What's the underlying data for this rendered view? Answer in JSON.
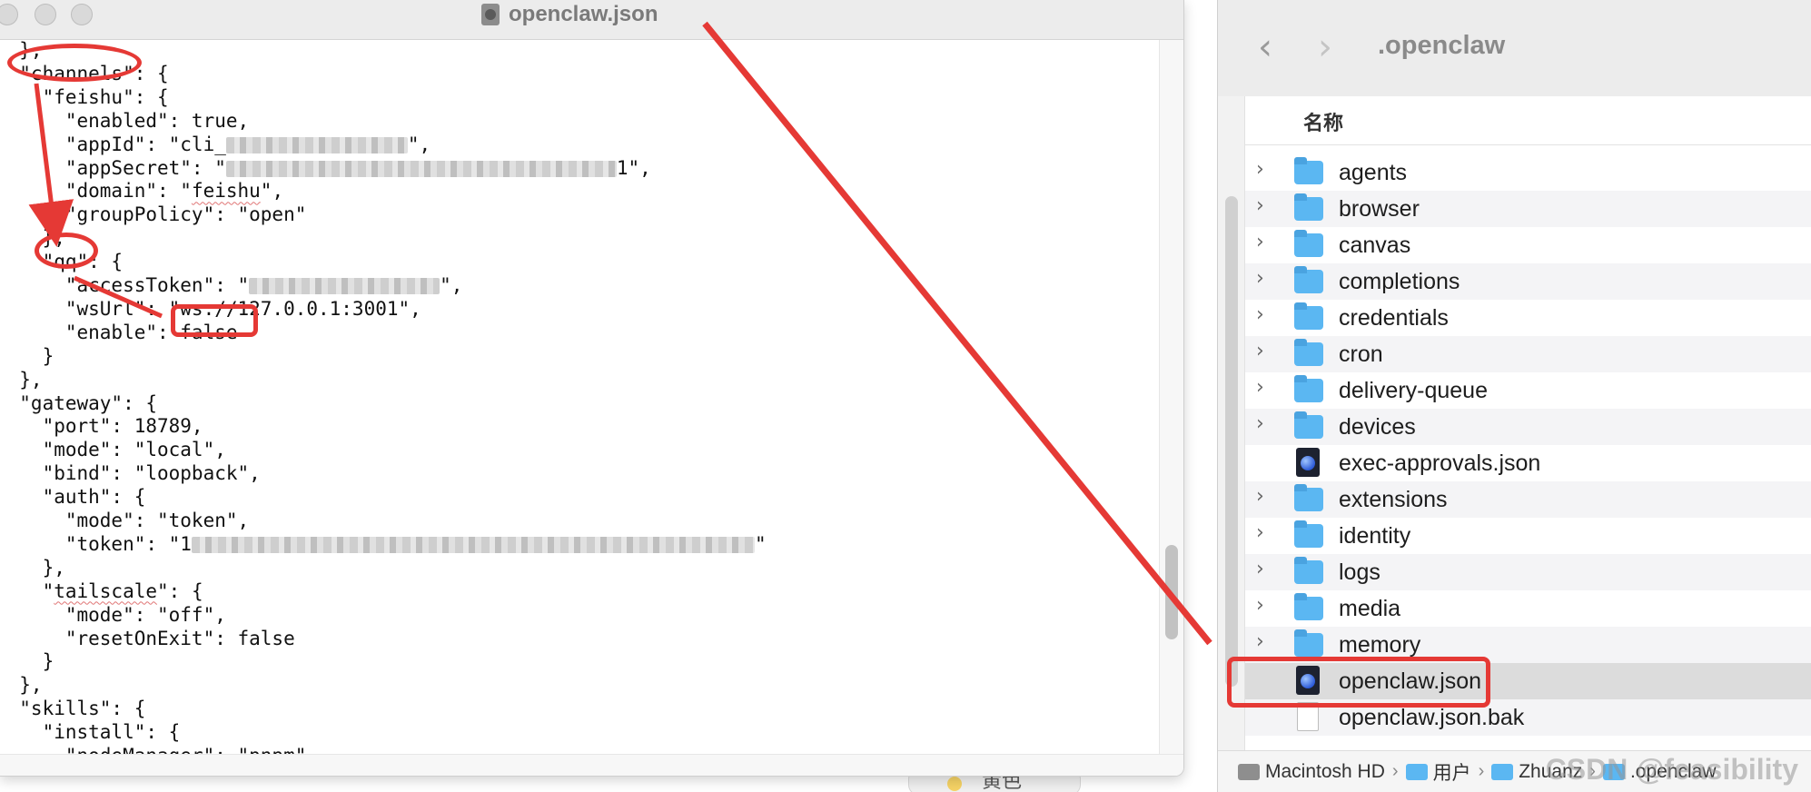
{
  "editor": {
    "title": "openclaw.json",
    "lines": [
      {
        "segments": [
          {
            "t": "  },"
          }
        ]
      },
      {
        "segments": [
          {
            "t": "  \"channels\": {"
          }
        ]
      },
      {
        "segments": [
          {
            "t": "    \"feishu\": {"
          }
        ]
      },
      {
        "segments": [
          {
            "t": "      \"enabled\": true,"
          }
        ]
      },
      {
        "segments": [
          {
            "t": "      \"appId\": \"cli_"
          },
          {
            "blur": 200
          },
          {
            "t": "\","
          }
        ]
      },
      {
        "segments": [
          {
            "t": "      \"appSecret\": \""
          },
          {
            "blur": 430
          },
          {
            "t": "1\","
          }
        ]
      },
      {
        "segments": [
          {
            "t": "      \"domain\": \""
          },
          {
            "t": "feishu",
            "sq": true
          },
          {
            "t": "\","
          }
        ]
      },
      {
        "segments": [
          {
            "t": "      \"groupPolicy\": \"open\""
          }
        ]
      },
      {
        "segments": [
          {
            "t": "    },"
          }
        ]
      },
      {
        "segments": [
          {
            "t": "    \"qq\": {"
          }
        ]
      },
      {
        "segments": [
          {
            "t": "      \"accessToken\": \""
          },
          {
            "blur": 210
          },
          {
            "t": "\","
          }
        ]
      },
      {
        "segments": [
          {
            "t": "      \"wsUrl\": \"ws://127.0.0.1:3001\","
          }
        ]
      },
      {
        "segments": [
          {
            "t": "      \"enable\": false"
          }
        ]
      },
      {
        "segments": [
          {
            "t": "    }"
          }
        ]
      },
      {
        "segments": [
          {
            "t": "  },"
          }
        ]
      },
      {
        "segments": [
          {
            "t": "  \"gateway\": {"
          }
        ]
      },
      {
        "segments": [
          {
            "t": "    \"port\": 18789,"
          }
        ]
      },
      {
        "segments": [
          {
            "t": "    \"mode\": \"local\","
          }
        ]
      },
      {
        "segments": [
          {
            "t": "    \"bind\": \"loopback\","
          }
        ]
      },
      {
        "segments": [
          {
            "t": "    \"auth\": {"
          }
        ]
      },
      {
        "segments": [
          {
            "t": "      \"mode\": \"token\","
          }
        ]
      },
      {
        "segments": [
          {
            "t": "      \"token\": \"1"
          },
          {
            "blur": 620
          },
          {
            "t": "\""
          }
        ]
      },
      {
        "segments": [
          {
            "t": "    },"
          }
        ]
      },
      {
        "segments": [
          {
            "t": "    \""
          },
          {
            "t": "tailscale",
            "sq": true
          },
          {
            "t": "\": {"
          }
        ]
      },
      {
        "segments": [
          {
            "t": "      \"mode\": \"off\","
          }
        ]
      },
      {
        "segments": [
          {
            "t": "      \"resetOnExit\": false"
          }
        ]
      },
      {
        "segments": [
          {
            "t": "    }"
          }
        ]
      },
      {
        "segments": [
          {
            "t": "  },"
          }
        ]
      },
      {
        "segments": [
          {
            "t": "  \"skills\": {"
          }
        ]
      },
      {
        "segments": [
          {
            "t": "    \"install\": {"
          }
        ]
      },
      {
        "segments": [
          {
            "t": "      \"nodeManager\": \"pnpm\""
          }
        ]
      }
    ]
  },
  "finder": {
    "title": ".openclaw",
    "column_header": "名称",
    "items": [
      {
        "name": "agents",
        "kind": "folder"
      },
      {
        "name": "browser",
        "kind": "folder"
      },
      {
        "name": "canvas",
        "kind": "folder"
      },
      {
        "name": "completions",
        "kind": "folder"
      },
      {
        "name": "credentials",
        "kind": "folder"
      },
      {
        "name": "cron",
        "kind": "folder"
      },
      {
        "name": "delivery-queue",
        "kind": "folder"
      },
      {
        "name": "devices",
        "kind": "folder"
      },
      {
        "name": "exec-approvals.json",
        "kind": "json"
      },
      {
        "name": "extensions",
        "kind": "folder"
      },
      {
        "name": "identity",
        "kind": "folder"
      },
      {
        "name": "logs",
        "kind": "folder"
      },
      {
        "name": "media",
        "kind": "folder"
      },
      {
        "name": "memory",
        "kind": "folder"
      },
      {
        "name": "openclaw.json",
        "kind": "json",
        "selected": true
      },
      {
        "name": "openclaw.json.bak",
        "kind": "file"
      }
    ],
    "path": [
      "Macintosh HD",
      "用户",
      "Zhuanz",
      ".openclaw"
    ]
  },
  "dock_peek": "黄色",
  "watermark": "CSDN @feasibility",
  "colors": {
    "annotation": "#e53935",
    "folder": "#5bb7f2"
  }
}
